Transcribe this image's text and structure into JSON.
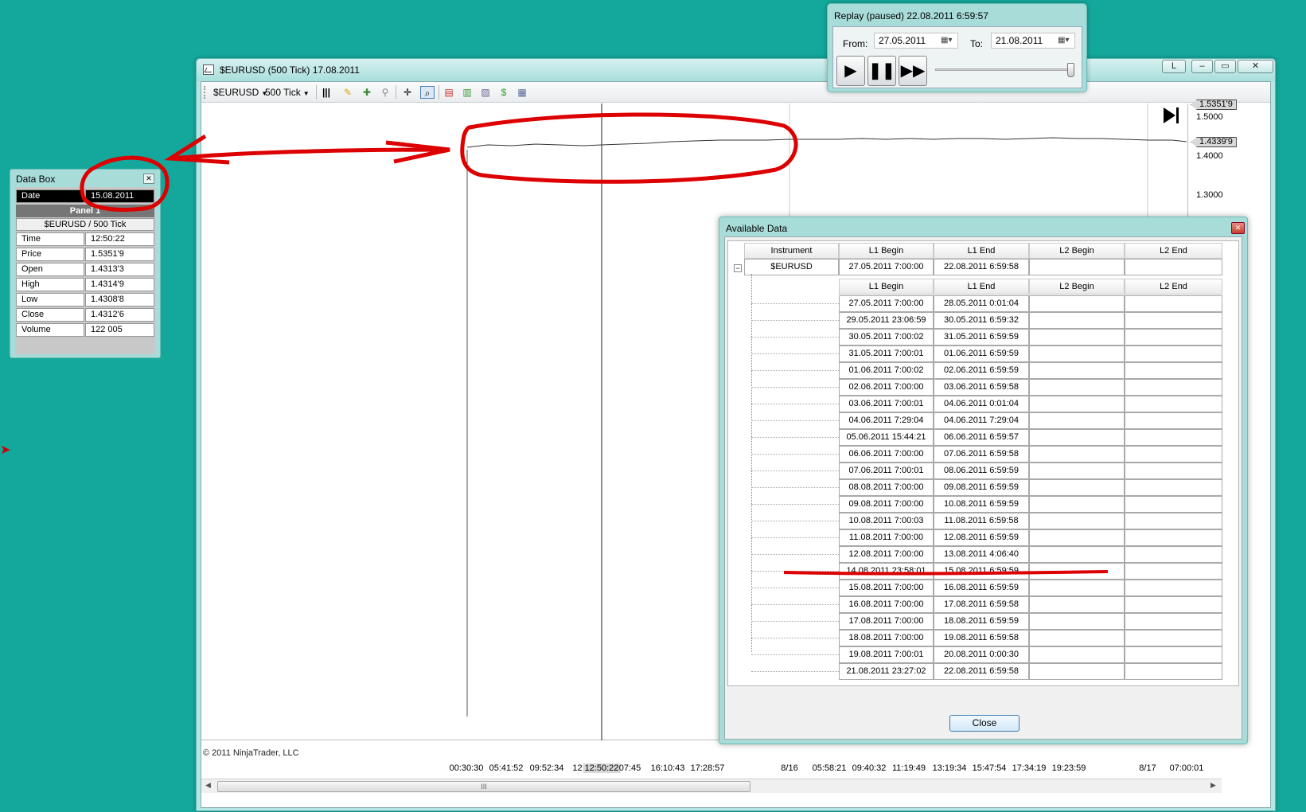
{
  "chart_window": {
    "title": "$EURUSD (500 Tick)  17.08.2011",
    "buttons": {
      "l_label": "L",
      "minimize": "–",
      "maximize": "▭",
      "close": "✕"
    },
    "toolbar": {
      "instrument": "$EURUSD",
      "interval": "500 Tick"
    },
    "price_ticks": [
      "1.5000",
      "1.4000",
      "1.3000"
    ],
    "price_tags": [
      "1.5351'9",
      "1.4339'9"
    ],
    "copyright": "© 2011 NinjaTrader, LLC",
    "time_ticks": [
      "00:30:30",
      "05:41:52",
      "09:52:34",
      "12:",
      "12:50:22",
      ":07:45",
      "16:10:43",
      "17:28:57",
      "8/16",
      "05:58:21",
      "09:40:32",
      "11:19:49",
      "13:19:34",
      "15:47:54",
      "17:34:19",
      "19:23:59",
      "8/17",
      "07:00:01"
    ],
    "scroll_thumb": "III"
  },
  "replay": {
    "title": "Replay (paused) 22.08.2011 6:59:57",
    "from_label": "From:",
    "from_value": "27.05.2011",
    "to_label": "To:",
    "to_value": "21.08.2011",
    "slider_position": 1.0
  },
  "data_box": {
    "title": "Data Box",
    "date_label": "Date",
    "date_value": "15.08.2011",
    "panel": "Panel 1",
    "instrument": "$EURUSD / 500 Tick",
    "rows": [
      {
        "k": "Time",
        "v": "12:50:22"
      },
      {
        "k": "Price",
        "v": "1.5351'9"
      },
      {
        "k": "Open",
        "v": "1.4313'3"
      },
      {
        "k": "High",
        "v": "1.4314'9"
      },
      {
        "k": "Low",
        "v": "1.4308'8"
      },
      {
        "k": "Close",
        "v": "1.4312'6"
      },
      {
        "k": "Volume",
        "v": "122 005"
      }
    ]
  },
  "available_data": {
    "title": "Available Data",
    "headers": [
      "Instrument",
      "L1 Begin",
      "L1 End",
      "L2 Begin",
      "L2 End"
    ],
    "instrument_row": [
      "$EURUSD",
      "27.05.2011 7:00:00",
      "22.08.2011 6:59:58",
      "",
      ""
    ],
    "sub_headers": [
      "L1 Begin",
      "L1 End",
      "L2 Begin",
      "L2 End"
    ],
    "rows": [
      [
        "27.05.2011 7:00:00",
        "28.05.2011 0:01:04"
      ],
      [
        "29.05.2011 23:06:59",
        "30.05.2011 6:59:32"
      ],
      [
        "30.05.2011 7:00:02",
        "31.05.2011 6:59:59"
      ],
      [
        "31.05.2011 7:00:01",
        "01.06.2011 6:59:59"
      ],
      [
        "01.06.2011 7:00:02",
        "02.06.2011 6:59:59"
      ],
      [
        "02.06.2011 7:00:00",
        "03.06.2011 6:59:58"
      ],
      [
        "03.06.2011 7:00:01",
        "04.06.2011 0:01:04"
      ],
      [
        "04.06.2011 7:29:04",
        "04.06.2011 7:29:04"
      ],
      [
        "05.06.2011 15:44:21",
        "06.06.2011 6:59:57"
      ],
      [
        "06.06.2011 7:00:00",
        "07.06.2011 6:59:58"
      ],
      [
        "07.06.2011 7:00:01",
        "08.06.2011 6:59:59"
      ],
      [
        "08.08.2011 7:00:00",
        "09.08.2011 6:59:59"
      ],
      [
        "09.08.2011 7:00:00",
        "10.08.2011 6:59:59"
      ],
      [
        "10.08.2011 7:00:03",
        "11.08.2011 6:59:58"
      ],
      [
        "11.08.2011 7:00:00",
        "12.08.2011 6:59:59"
      ],
      [
        "12.08.2011 7:00:00",
        "13.08.2011 4:06:40"
      ],
      [
        "14.08.2011 23:58:01",
        "15.08.2011 6:59:59"
      ],
      [
        "15.08.2011 7:00:00",
        "16.08.2011 6:59:59"
      ],
      [
        "16.08.2011 7:00:00",
        "17.08.2011 6:59:58"
      ],
      [
        "17.08.2011 7:00:00",
        "18.08.2011 6:59:59"
      ],
      [
        "18.08.2011 7:00:00",
        "19.08.2011 6:59:58"
      ],
      [
        "19.08.2011 7:00:01",
        "20.08.2011 0:00:30"
      ],
      [
        "21.08.2011 23:27:02",
        "22.08.2011 6:59:58"
      ]
    ],
    "close_label": "Close"
  },
  "colors": {
    "desktop": "#14a79b",
    "annotation": "#dd0000"
  }
}
